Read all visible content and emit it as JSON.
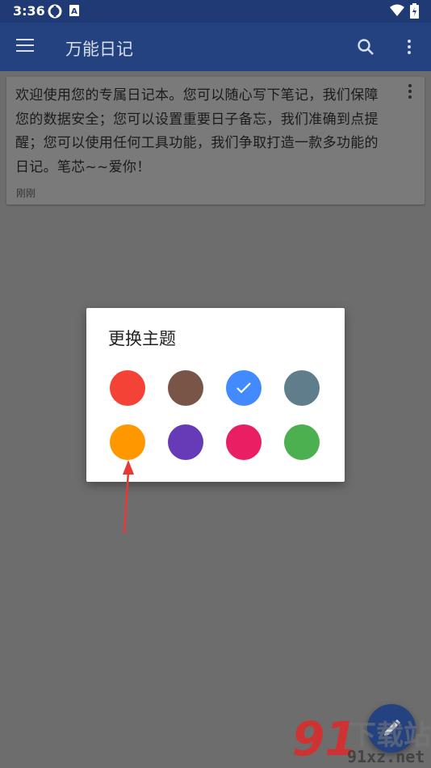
{
  "status_bar": {
    "time": "3:36",
    "left_icons": [
      "sync-icon",
      "a-badge-icon"
    ],
    "right_icons": [
      "wifi-icon",
      "battery-charging-icon"
    ]
  },
  "app_bar": {
    "title": "万能日记",
    "menu_icon": "hamburger-menu-icon",
    "search_icon": "search-icon",
    "more_icon": "more-vert-icon"
  },
  "note_card": {
    "lines": [
      "欢迎使用您的专属日记本。您可以随心写下笔记，我们保障",
      "您的数据安全；您可以设置重要日子备忘，我们准确到点提",
      "醒；您可以使用任何工具功能，我们争取打造一款多功能的",
      "日记。笔芯~~爱你！"
    ],
    "time": "刚刚"
  },
  "theme_dialog": {
    "title": "更换主题",
    "colors": [
      {
        "name": "red",
        "hex": "#f44336",
        "selected": false
      },
      {
        "name": "brown",
        "hex": "#795548",
        "selected": false
      },
      {
        "name": "blue",
        "hex": "#448aff",
        "selected": true
      },
      {
        "name": "blue-grey",
        "hex": "#607d8b",
        "selected": false
      },
      {
        "name": "orange",
        "hex": "#ff9800",
        "selected": false
      },
      {
        "name": "purple",
        "hex": "#673ab7",
        "selected": false
      },
      {
        "name": "pink",
        "hex": "#e91e63",
        "selected": false
      },
      {
        "name": "green",
        "hex": "#4caf50",
        "selected": false
      }
    ]
  },
  "annotation": {
    "color": "#e53935",
    "points_to": "orange"
  },
  "fab": {
    "icon": "edit-pencil-icon",
    "color": "#24427f"
  },
  "watermark": {
    "logo": "91",
    "top_text": "下载站",
    "site": "91xz.net"
  }
}
